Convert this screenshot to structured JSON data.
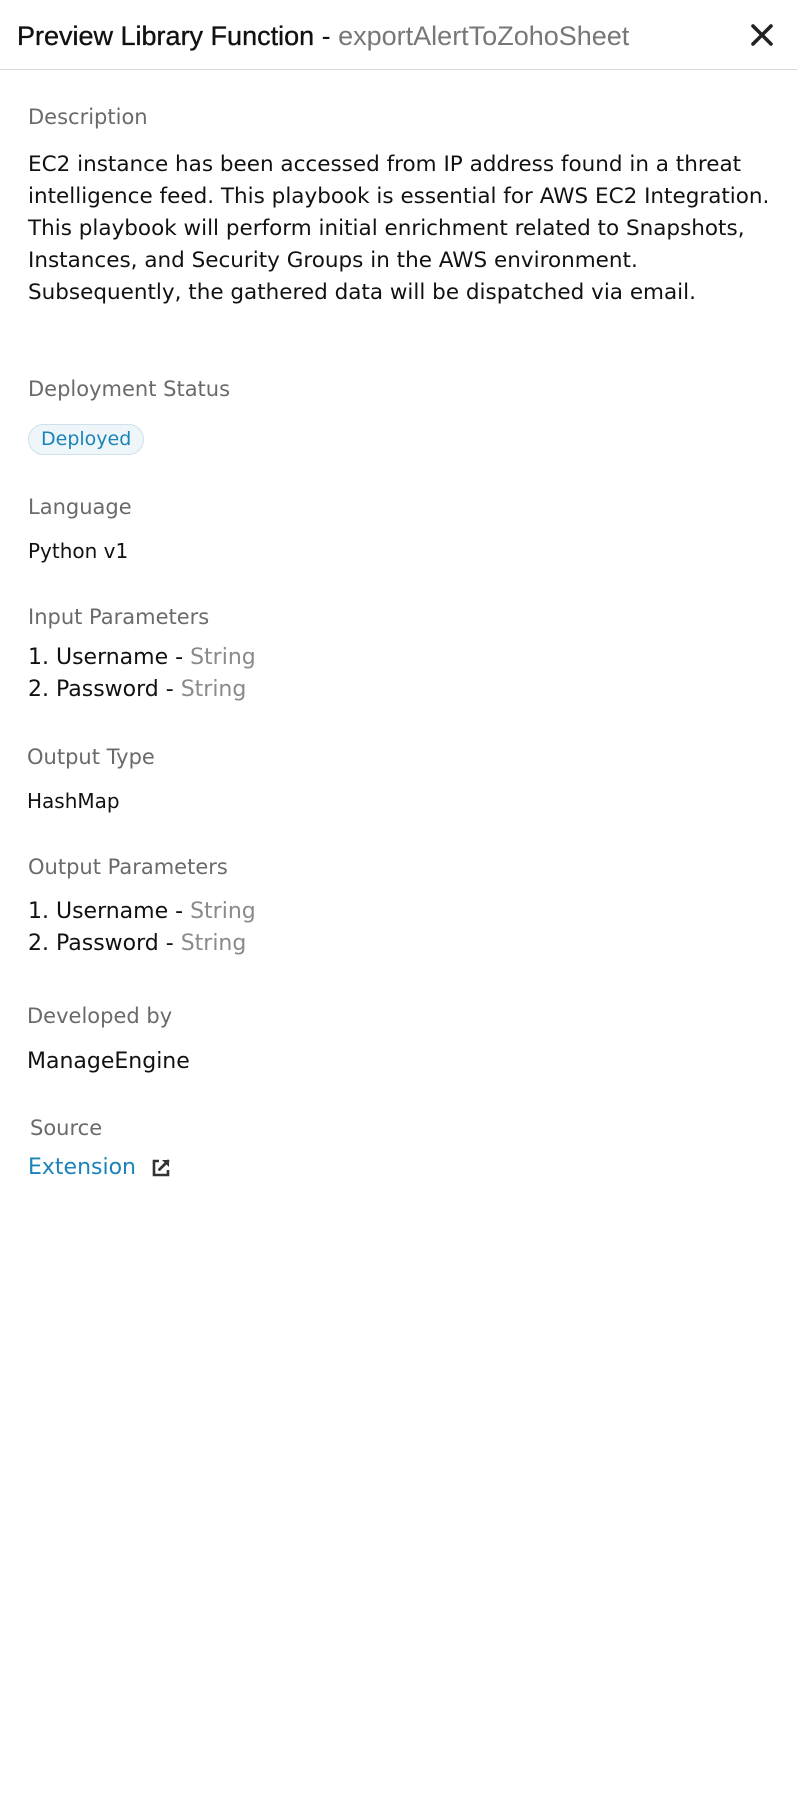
{
  "header": {
    "title": "Preview Library Function",
    "separator": " - ",
    "function_name": "exportAlertToZohoSheet"
  },
  "description": {
    "label": "Description",
    "text": "EC2 instance has been accessed from IP address found in a threat intelligence feed. This playbook is essential for AWS EC2 Integration. This playbook will perform initial enrichment related to Snapshots, Instances, and Security Groups in the AWS environment. Subsequently, the gathered data will be dispatched via email."
  },
  "deployment_status": {
    "label": "Deployment Status",
    "value": "Deployed"
  },
  "language": {
    "label": "Language",
    "value": "Python v1"
  },
  "input_parameters": {
    "label": "Input Parameters",
    "items": [
      {
        "prefix": "1. ",
        "name": "Username",
        "sep": " - ",
        "type": "String"
      },
      {
        "prefix": "2. ",
        "name": "Password",
        "sep": " - ",
        "type": "String"
      }
    ]
  },
  "output_type": {
    "label": "Output Type",
    "value": "HashMap"
  },
  "output_parameters": {
    "label": "Output Parameters",
    "items": [
      {
        "prefix": "1. ",
        "name": "Username",
        "sep": " - ",
        "type": "String"
      },
      {
        "prefix": "2. ",
        "name": "Password",
        "sep": " - ",
        "type": "String"
      }
    ]
  },
  "developed_by": {
    "label": "Developed by",
    "value": "ManageEngine"
  },
  "source": {
    "label": "Source",
    "link_text": "Extension"
  },
  "icons": {
    "close": "close-icon",
    "external_link": "external-link-icon"
  },
  "colors": {
    "link": "#1a84b8",
    "muted": "#8a8a8a",
    "badge_bg": "#eef6fa"
  }
}
